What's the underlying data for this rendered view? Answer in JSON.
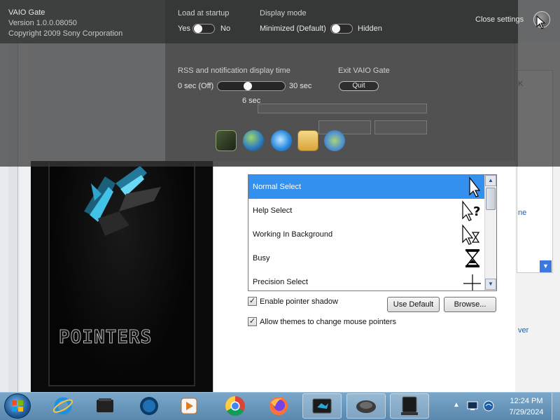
{
  "vaio_gate": {
    "app_name": "VAIO Gate",
    "version": "Version 1.0.0.08050",
    "copyright": "Copyright 2009 Sony Corporation",
    "close_settings_label": "Close settings",
    "load_at_startup": {
      "label": "Load at startup",
      "on_label": "Yes",
      "off_label": "No",
      "value": "Yes"
    },
    "display_mode": {
      "label": "Display mode",
      "on_label": "Minimized (Default)",
      "off_label": "Hidden",
      "value": "Minimized (Default)"
    },
    "rss_time": {
      "label": "RSS and notification display time",
      "min_label": "0 sec (Off)",
      "max_label": "30 sec",
      "current_label": "6 sec",
      "value_sec": 6,
      "max_sec": 30
    },
    "exit": {
      "label": "Exit VAIO Gate",
      "button_label": "Quit"
    },
    "dock_icons": [
      "vaio-media-icon",
      "internet-globe-icon",
      "ie-icon",
      "mail-icon",
      "network-icon"
    ]
  },
  "pointers_dialog": {
    "preview_text": "POINTERS",
    "list_items": [
      {
        "label": "Normal Select",
        "icon": "arrow-cursor-icon",
        "selected": true
      },
      {
        "label": "Help Select",
        "icon": "help-cursor-icon",
        "selected": false
      },
      {
        "label": "Working In Background",
        "icon": "working-cursor-icon",
        "selected": false
      },
      {
        "label": "Busy",
        "icon": "hourglass-cursor-icon",
        "selected": false
      },
      {
        "label": "Precision Select",
        "icon": "crosshair-cursor-icon",
        "selected": false
      }
    ],
    "enable_shadow": {
      "label": "Enable pointer shadow",
      "checked": true
    },
    "allow_themes": {
      "label": "Allow themes to change mouse pointers",
      "checked": true
    },
    "use_default_label": "Use Default",
    "browse_label": "Browse..."
  },
  "background_window": {
    "link_fragment_1": "ne",
    "link_fragment_2": "ver",
    "text_fragment": "K"
  },
  "taskbar": {
    "items": [
      "ie-icon",
      "explorer-icon",
      "globe-icon",
      "media-player-icon",
      "chrome-icon",
      "firefox-icon",
      "vaio-window-icon",
      "mouse-settings-icon",
      "laptop-icon"
    ],
    "time": "12:24 PM",
    "date": "7/29/2024"
  },
  "colors": {
    "selection": "#3390ef",
    "overlay": "#3a3a3a",
    "taskbar": "#6a97bb"
  }
}
